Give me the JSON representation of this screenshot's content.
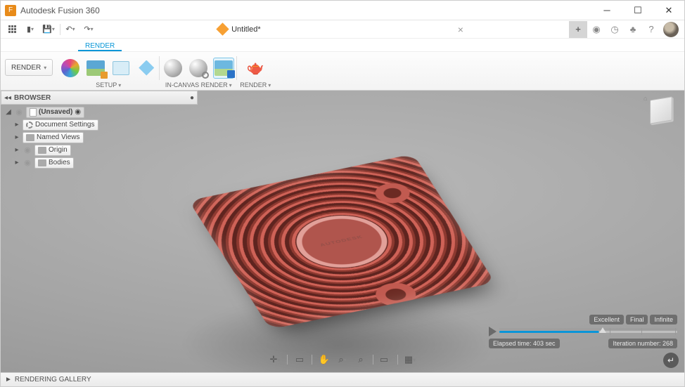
{
  "app": {
    "title": "Autodesk Fusion 360"
  },
  "document": {
    "tab_title": "Untitled*"
  },
  "quickbar": {
    "undo_bg": "#aaa"
  },
  "workspace": {
    "active_tab": "RENDER",
    "render_button": "RENDER"
  },
  "ribbon": {
    "setup_label": "SETUP",
    "incanvas_label": "IN-CANVAS RENDER",
    "render_label": "RENDER"
  },
  "browser": {
    "header": "BROWSER",
    "root": "(Unsaved)",
    "items": [
      {
        "label": "Document Settings"
      },
      {
        "label": "Named Views"
      },
      {
        "label": "Origin"
      },
      {
        "label": "Bodies"
      }
    ]
  },
  "render_progress": {
    "quality_levels": [
      "Excellent",
      "Final",
      "Infinite"
    ],
    "elapsed_label": "Elapsed time: 403 sec",
    "iteration_label": "Iteration number: 268",
    "progress_pct": 56
  },
  "statusbar": {
    "label": "RENDERING GALLERY"
  },
  "icons": {
    "orbit": "⟲",
    "pan": "✥",
    "zoom": "⌕",
    "look": "👁",
    "grid": "▦",
    "display": "▭",
    "home": "⌂",
    "pencil": "✎",
    "plus": "+",
    "globe": "◉",
    "clock": "◷",
    "bell": "🔔",
    "help": "?",
    "save": "💾",
    "new": "📄",
    "recycle": "♻",
    "expand": "▸",
    "expand_down": "◢"
  }
}
